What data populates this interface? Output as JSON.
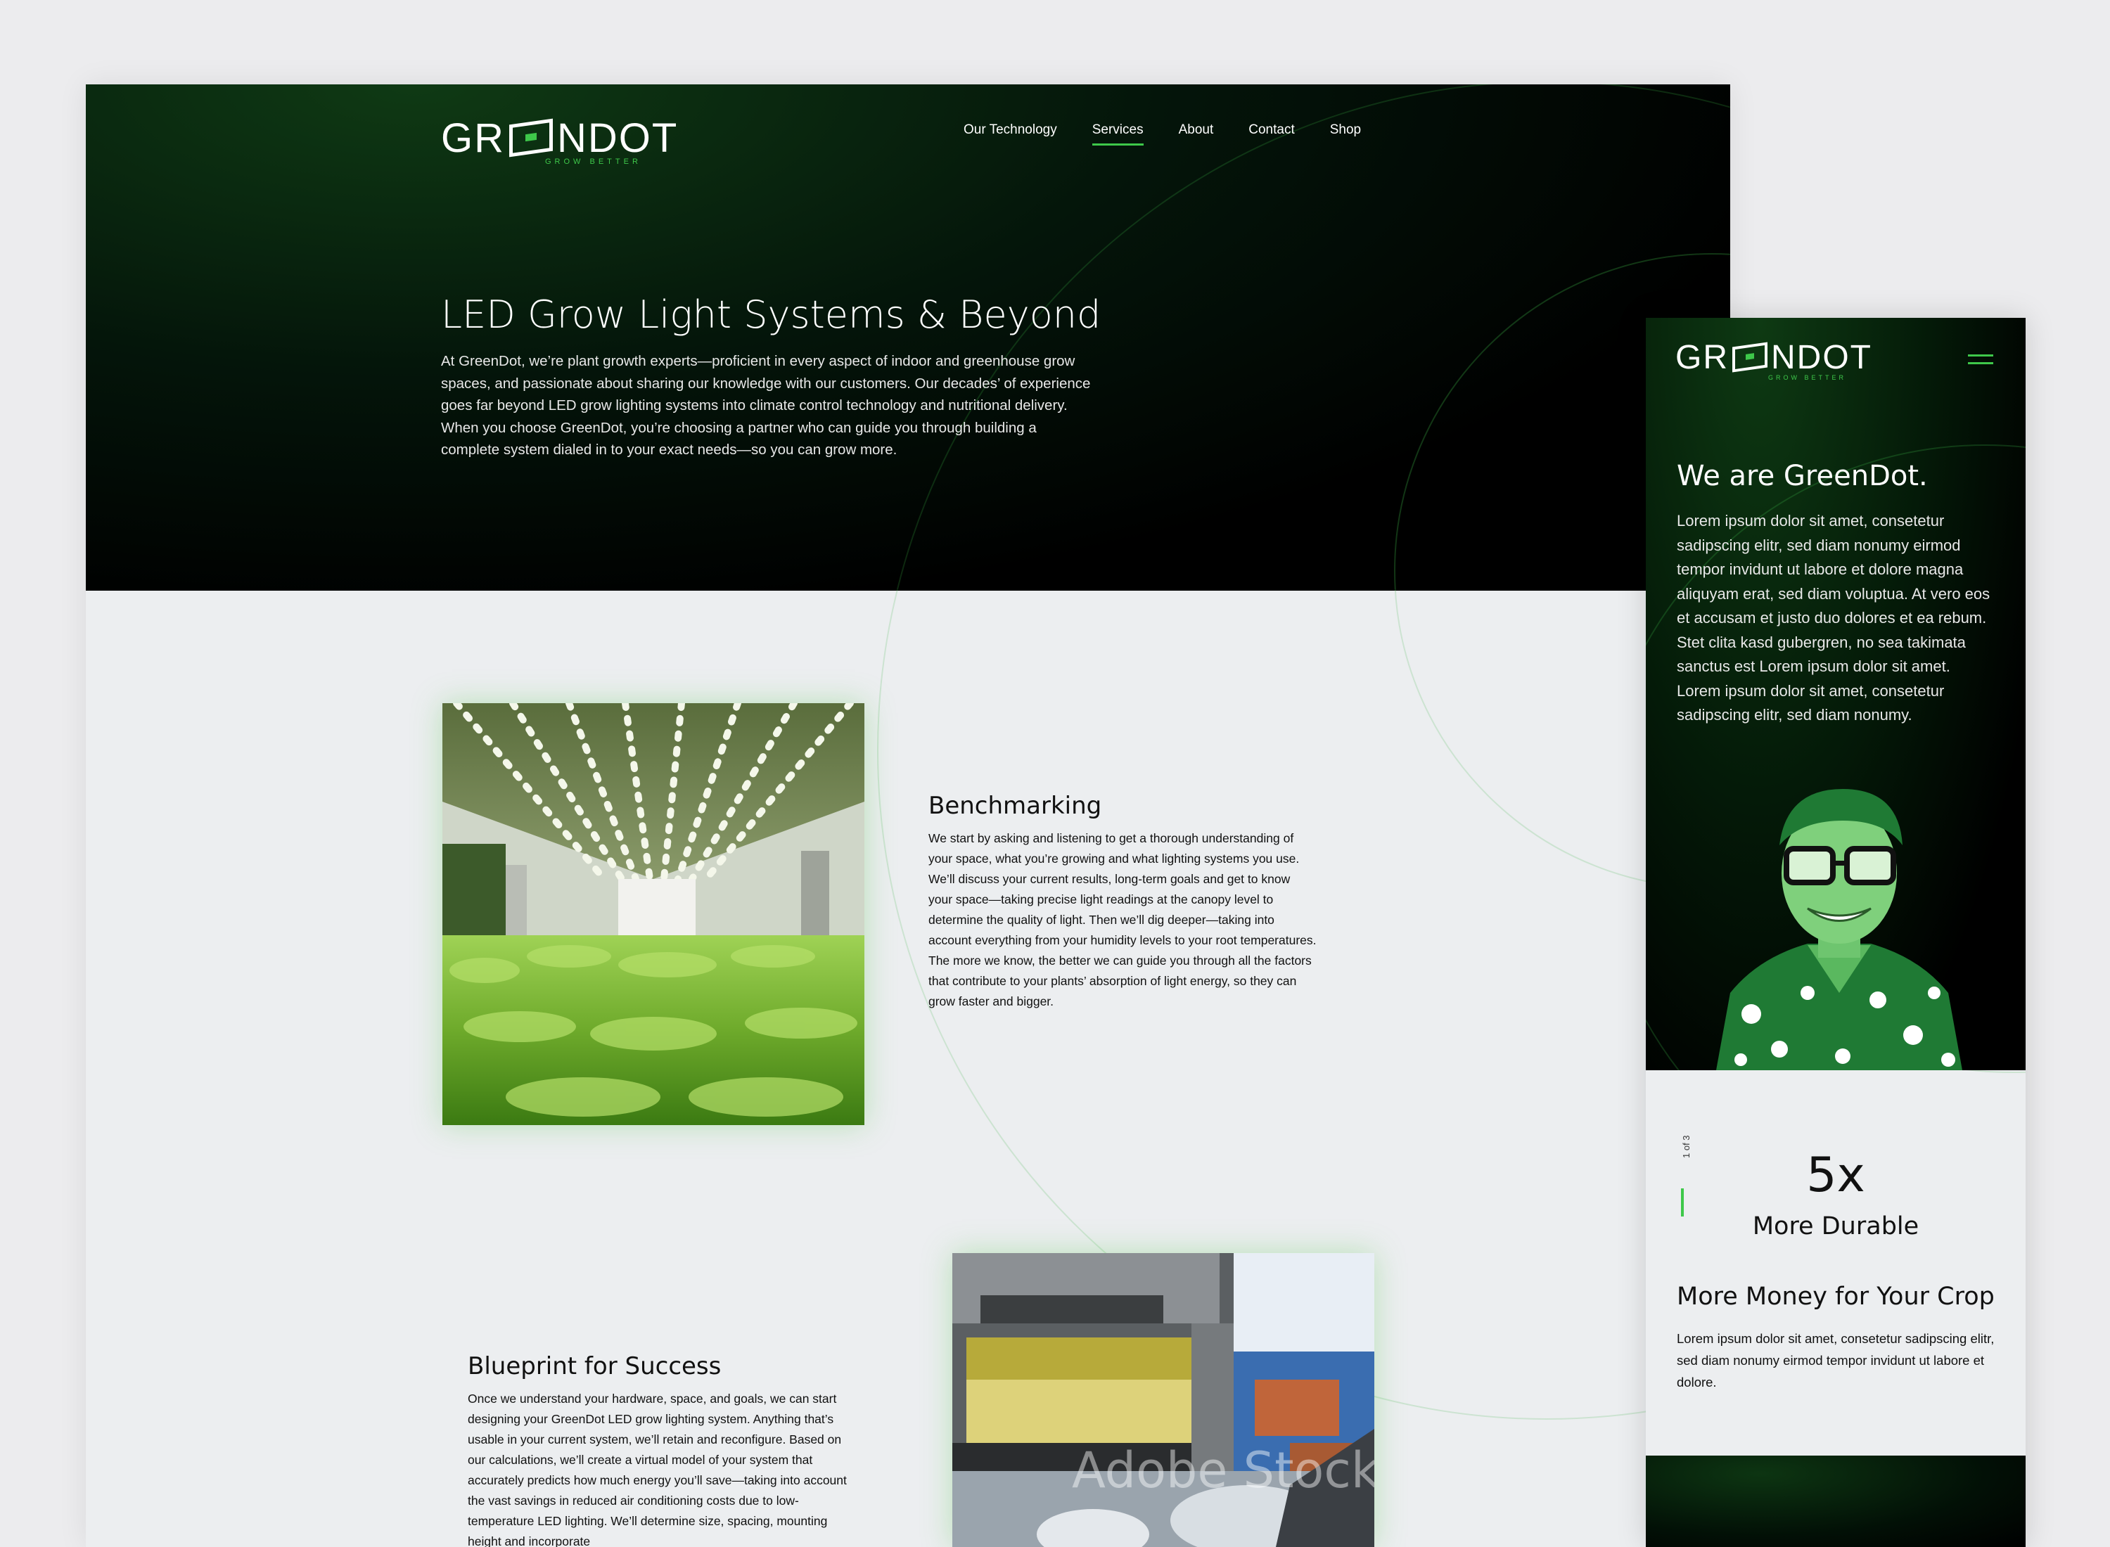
{
  "desktop": {
    "logo": {
      "text_left": "GR",
      "text_right": "NDOT",
      "tagline": "GROW BETTER"
    },
    "nav": [
      {
        "label": "Our Technology",
        "active": false
      },
      {
        "label": "Services",
        "active": true
      },
      {
        "label": "About",
        "active": false
      },
      {
        "label": "Contact",
        "active": false
      },
      {
        "label": "Shop",
        "active": false
      }
    ],
    "hero": {
      "title": "LED Grow Light Systems & Beyond",
      "body": "At GreenDot, we’re plant growth experts—proficient in every aspect of indoor and greenhouse grow spaces, and passionate about sharing our knowledge with our customers. Our decades’ of experience goes far beyond LED grow lighting systems into climate control technology and nutritional delivery. When you choose GreenDot, you’re choosing a partner who can guide you through building a complete system dialed in to your exact needs—so you can grow more."
    },
    "sections": [
      {
        "title": "Benchmarking",
        "body": "We start by asking and listening to get a thorough understanding of your space, what you’re growing and what lighting systems you use. We’ll discuss your current results, long-term goals and get to know your space—taking precise light readings at the canopy level to determine the quality of light. Then we’ll dig deeper—taking into account everything from your humidity levels to your root temperatures. The more we know, the better we can guide you through all the factors that contribute to your plants’ absorption of light energy, so they can grow faster and bigger."
      },
      {
        "title": "Blueprint for Success",
        "body": "Once we understand your hardware, space, and goals, we can start designing your GreenDot LED grow lighting system. Anything that’s usable in your current system, we’ll retain and reconfigure. Based on our calculations, we’ll create a virtual model of your system that accurately predicts how much energy you’ll save—taking into account the vast savings in reduced air conditioning costs due to low-temperature LED lighting. We’ll determine size, spacing, mounting height and incorporate"
      }
    ],
    "watermark": "Adobe Stock"
  },
  "mobile": {
    "logo": {
      "text_left": "GR",
      "text_right": "NDOT",
      "tagline": "GROW BETTER"
    },
    "title": "We are GreenDot.",
    "body": "Lorem ipsum dolor sit amet, consetetur sadipscing elitr, sed diam nonumy eirmod tempor invidunt ut labore et dolore magna aliquyam erat, sed diam voluptua. At vero eos et accusam et justo duo dolores et ea rebum. Stet clita kasd gubergren, no sea takimata sanctus est Lorem ipsum dolor sit amet. Lorem ipsum dolor sit amet, consetetur sadipscing elitr, sed diam nonumy.",
    "stat": {
      "counter": "1 of 3",
      "value": "5x",
      "label": "More Durable"
    },
    "section": {
      "title": "More Money for Your Crop",
      "body": "Lorem ipsum dolor sit amet, consetetur sadipscing elitr, sed diam nonumy eirmod tempor invidunt ut labore et dolore."
    }
  },
  "colors": {
    "accent": "#3ec84a",
    "dark": "#000000",
    "light_bg": "#eceef0"
  }
}
